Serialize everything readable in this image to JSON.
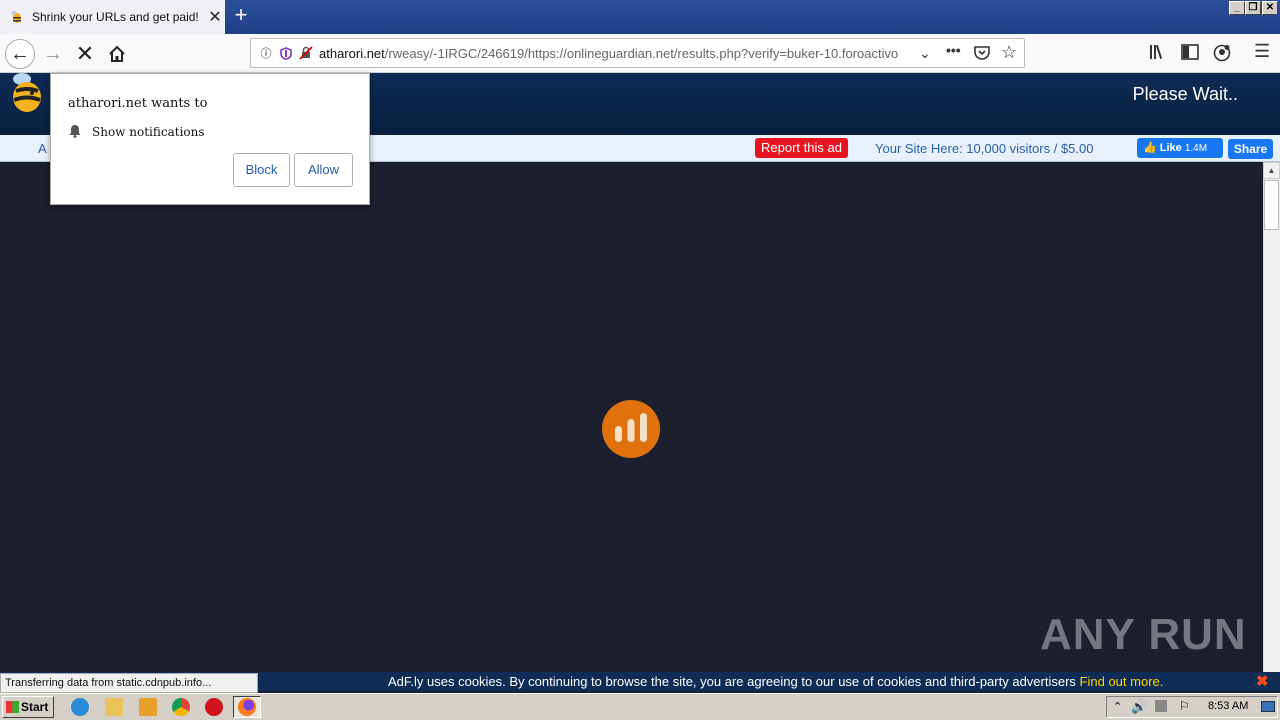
{
  "browser": {
    "tab_title": "Shrink your URLs and get paid!",
    "url_domain": "atharori.net",
    "url_path": "/rweasy/-1IRGC/246619/https://onlineguardian.net/results.php?verify=buker-10.foroactivo"
  },
  "site": {
    "status": "Please Wait..",
    "ad_left_fragment": "A",
    "report_ad": "Report this ad",
    "your_site": "Your Site Here: 10,000 visitors / $5.00",
    "fb_like": "Like",
    "fb_like_count": "1.4M",
    "fb_share": "Share"
  },
  "popup": {
    "title": "atharori.net wants to",
    "permission": "Show notifications",
    "block_label": "Block",
    "allow_label": "Allow"
  },
  "cookie": {
    "text": "AdF.ly uses cookies. By continuing to browse the site, you are agreeing to our use of cookies and third-party advertisers",
    "link": "Find out more."
  },
  "status_text": "Transferring data from static.cdnpub.info...",
  "watermark": "ANY RUN",
  "taskbar": {
    "start_label": "Start",
    "clock": "8:53 AM"
  },
  "colors": {
    "loader": "#e0720d",
    "report_ad": "#e8141f",
    "cookie_link": "#ffd400",
    "fb": "#1877f2"
  }
}
